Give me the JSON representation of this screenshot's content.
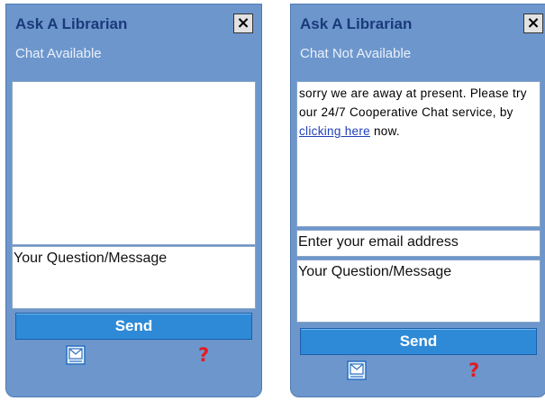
{
  "widgets": [
    {
      "title": "Ask A Librarian",
      "close_label": "×",
      "status": "Chat Available",
      "message_placeholder": "Your Question/Message",
      "send_label": "Send",
      "help_label": "?"
    },
    {
      "title": "Ask A Librarian",
      "close_label": "×",
      "status": "Chat Not Available",
      "away_text_before": "sorry we are away at present. Please try our 24/7 Cooperative Chat service, by ",
      "away_link": "clicking here",
      "away_text_after": " now.",
      "email_placeholder": "Enter your email address",
      "message_placeholder": "Your Question/Message",
      "send_label": "Send",
      "help_label": "?"
    }
  ],
  "icons": {
    "email": "email-icon",
    "help": "help-icon",
    "close": "close-icon"
  },
  "colors": {
    "panel": "#6d97cc",
    "title": "#1a3a7a",
    "send_button": "#2e8ad6",
    "help": "#e31b23",
    "link": "#1f3fb8"
  }
}
